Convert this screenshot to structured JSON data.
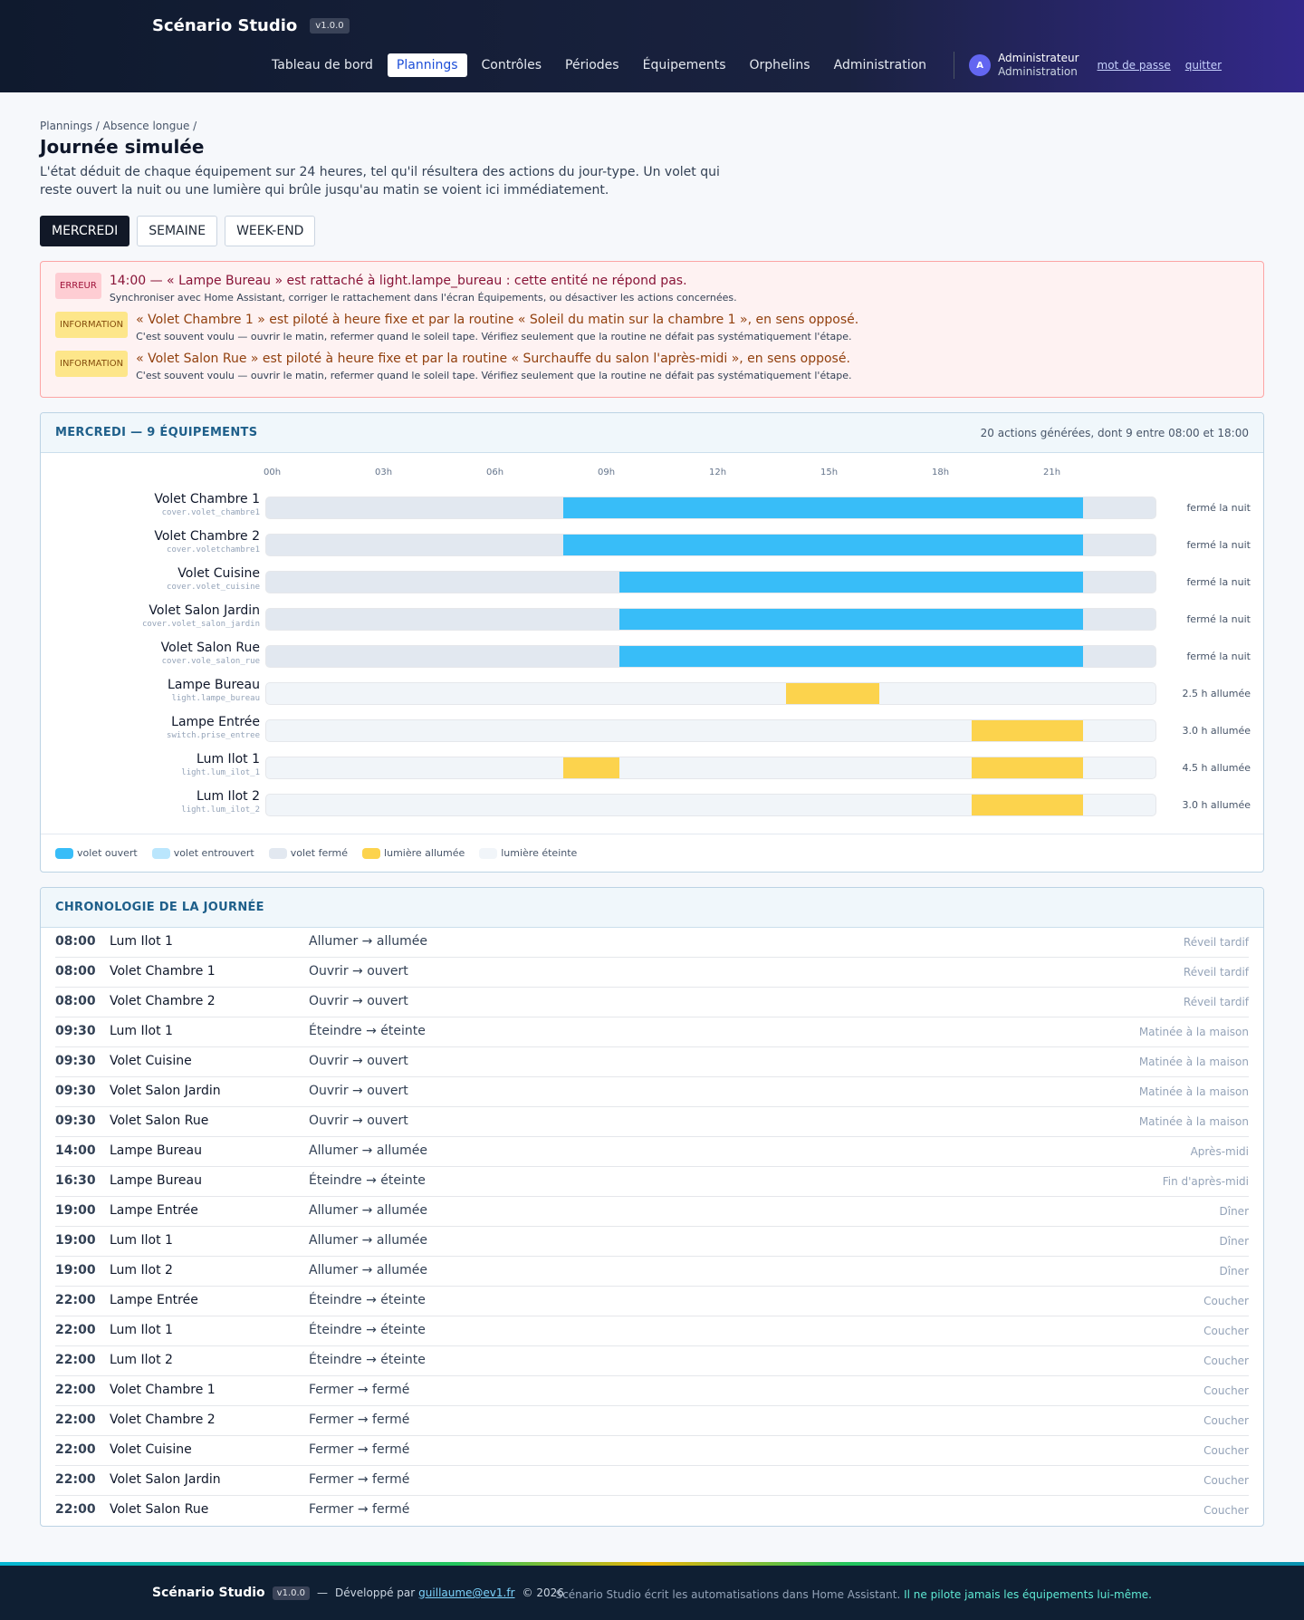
{
  "app": {
    "name": "Scénario Studio",
    "version": "v1.0.0"
  },
  "nav": [
    {
      "label": "Tableau de bord",
      "active": false
    },
    {
      "label": "Plannings",
      "active": true
    },
    {
      "label": "Contrôles",
      "active": false
    },
    {
      "label": "Périodes",
      "active": false
    },
    {
      "label": "Équipements",
      "active": false
    },
    {
      "label": "Orphelins",
      "active": false
    },
    {
      "label": "Administration",
      "active": false
    }
  ],
  "user": {
    "initial": "A",
    "name": "Administrateur",
    "role": "Administration",
    "password_link": "mot de passe",
    "logout_link": "quitter"
  },
  "page": {
    "breadcrumb": "Plannings / Absence longue /",
    "title": "Journée simulée",
    "description": "L'état déduit de chaque équipement sur 24 heures, tel qu'il résultera des actions du jour-type. Un volet qui reste ouvert la nuit ou une lumière qui brûle jusqu'au matin se voient ici immédiatement."
  },
  "day_tabs": [
    {
      "label": "MERCREDI",
      "active": true
    },
    {
      "label": "SEMAINE",
      "active": false
    },
    {
      "label": "WEEK-END",
      "active": false
    }
  ],
  "alerts": [
    {
      "level": "err",
      "badge": "ERREUR",
      "message": "14:00 — « Lampe Bureau » est rattaché à light.lampe_bureau : cette entité ne répond pas.",
      "detail": "Synchroniser avec Home Assistant, corriger le rattachement dans l'écran Équipements, ou désactiver les actions concernées."
    },
    {
      "level": "info",
      "badge": "INFORMATION",
      "message": "« Volet Chambre 1 » est piloté à heure fixe et par la routine « Soleil du matin sur la chambre 1 », en sens opposé.",
      "detail": "C'est souvent voulu — ouvrir le matin, refermer quand le soleil tape. Vérifiez seulement que la routine ne défait pas systématiquement l'étape."
    },
    {
      "level": "info",
      "badge": "INFORMATION",
      "message": "« Volet Salon Rue » est piloté à heure fixe et par la routine « Surchauffe du salon l'après-midi », en sens opposé.",
      "detail": "C'est souvent voulu — ouvrir le matin, refermer quand le soleil tape. Vérifiez seulement que la routine ne défait pas systématiquement l'étape."
    }
  ],
  "timeline": {
    "title": "MERCREDI — 9 ÉQUIPEMENTS",
    "meta": "20 actions générées, dont 9 entre 08:00 et 18:00",
    "ticks": [
      "00h",
      "03h",
      "06h",
      "09h",
      "12h",
      "15h",
      "18h",
      "21h"
    ],
    "rows": [
      {
        "name": "Volet Chambre 1",
        "entity": "cover.volet_chambre1",
        "kind": "cover",
        "segments": [
          [
            8,
            22
          ]
        ],
        "summary": "fermé la nuit"
      },
      {
        "name": "Volet Chambre 2",
        "entity": "cover.voletchambre1",
        "kind": "cover",
        "segments": [
          [
            8,
            22
          ]
        ],
        "summary": "fermé la nuit"
      },
      {
        "name": "Volet Cuisine",
        "entity": "cover.volet_cuisine",
        "kind": "cover",
        "segments": [
          [
            9.5,
            22
          ]
        ],
        "summary": "fermé la nuit"
      },
      {
        "name": "Volet Salon Jardin",
        "entity": "cover.volet_salon_jardin",
        "kind": "cover",
        "segments": [
          [
            9.5,
            22
          ]
        ],
        "summary": "fermé la nuit"
      },
      {
        "name": "Volet Salon Rue",
        "entity": "cover.vole_salon_rue",
        "kind": "cover",
        "segments": [
          [
            9.5,
            22
          ]
        ],
        "summary": "fermé la nuit"
      },
      {
        "name": "Lampe Bureau",
        "entity": "light.lampe_bureau",
        "kind": "light",
        "segments": [
          [
            14,
            16.5
          ]
        ],
        "summary": "2.5 h allumée"
      },
      {
        "name": "Lampe Entrée",
        "entity": "switch.prise_entree",
        "kind": "light",
        "segments": [
          [
            19,
            22
          ]
        ],
        "summary": "3.0 h allumée"
      },
      {
        "name": "Lum Ilot 1",
        "entity": "light.lum_ilot_1",
        "kind": "light",
        "segments": [
          [
            8,
            9.5
          ],
          [
            19,
            22
          ]
        ],
        "summary": "4.5 h allumée"
      },
      {
        "name": "Lum Ilot 2",
        "entity": "light.lum_ilot_2",
        "kind": "light",
        "segments": [
          [
            19,
            22
          ]
        ],
        "summary": "3.0 h allumée"
      }
    ],
    "legend": [
      {
        "label": "volet ouvert",
        "color": "#38bdf8"
      },
      {
        "label": "volet entrouvert",
        "color": "#bae6fd"
      },
      {
        "label": "volet fermé",
        "color": "#e2e8f0"
      },
      {
        "label": "lumière allumée",
        "color": "#fcd34d"
      },
      {
        "label": "lumière éteinte",
        "color": "#f1f5f9"
      }
    ]
  },
  "chronology": {
    "title": "CHRONOLOGIE DE LA JOURNÉE",
    "rows": [
      {
        "time": "08:00",
        "equip": "Lum Ilot 1",
        "action": "Allumer → allumée",
        "period": "Réveil tardif"
      },
      {
        "time": "08:00",
        "equip": "Volet Chambre 1",
        "action": "Ouvrir → ouvert",
        "period": "Réveil tardif"
      },
      {
        "time": "08:00",
        "equip": "Volet Chambre 2",
        "action": "Ouvrir → ouvert",
        "period": "Réveil tardif"
      },
      {
        "time": "09:30",
        "equip": "Lum Ilot 1",
        "action": "Éteindre → éteinte",
        "period": "Matinée à la maison"
      },
      {
        "time": "09:30",
        "equip": "Volet Cuisine",
        "action": "Ouvrir → ouvert",
        "period": "Matinée à la maison"
      },
      {
        "time": "09:30",
        "equip": "Volet Salon Jardin",
        "action": "Ouvrir → ouvert",
        "period": "Matinée à la maison"
      },
      {
        "time": "09:30",
        "equip": "Volet Salon Rue",
        "action": "Ouvrir → ouvert",
        "period": "Matinée à la maison"
      },
      {
        "time": "14:00",
        "equip": "Lampe Bureau",
        "action": "Allumer → allumée",
        "period": "Après-midi"
      },
      {
        "time": "16:30",
        "equip": "Lampe Bureau",
        "action": "Éteindre → éteinte",
        "period": "Fin d'après-midi"
      },
      {
        "time": "19:00",
        "equip": "Lampe Entrée",
        "action": "Allumer → allumée",
        "period": "Dîner"
      },
      {
        "time": "19:00",
        "equip": "Lum Ilot 1",
        "action": "Allumer → allumée",
        "period": "Dîner"
      },
      {
        "time": "19:00",
        "equip": "Lum Ilot 2",
        "action": "Allumer → allumée",
        "period": "Dîner"
      },
      {
        "time": "22:00",
        "equip": "Lampe Entrée",
        "action": "Éteindre → éteinte",
        "period": "Coucher"
      },
      {
        "time": "22:00",
        "equip": "Lum Ilot 1",
        "action": "Éteindre → éteinte",
        "period": "Coucher"
      },
      {
        "time": "22:00",
        "equip": "Lum Ilot 2",
        "action": "Éteindre → éteinte",
        "period": "Coucher"
      },
      {
        "time": "22:00",
        "equip": "Volet Chambre 1",
        "action": "Fermer → fermé",
        "period": "Coucher"
      },
      {
        "time": "22:00",
        "equip": "Volet Chambre 2",
        "action": "Fermer → fermé",
        "period": "Coucher"
      },
      {
        "time": "22:00",
        "equip": "Volet Cuisine",
        "action": "Fermer → fermé",
        "period": "Coucher"
      },
      {
        "time": "22:00",
        "equip": "Volet Salon Jardin",
        "action": "Fermer → fermé",
        "period": "Coucher"
      },
      {
        "time": "22:00",
        "equip": "Volet Salon Rue",
        "action": "Fermer → fermé",
        "period": "Coucher"
      }
    ]
  },
  "footer": {
    "brand": "Scénario Studio",
    "version": "v1.0.0",
    "dash": "—",
    "dev_prefix": "Développé par",
    "dev_link": "guillaume@ev1.fr",
    "copyright": "© 2026",
    "note": "Scénario Studio écrit les automatisations dans Home Assistant.",
    "note_highlight": "Il ne pilote jamais les équipements lui-même."
  }
}
